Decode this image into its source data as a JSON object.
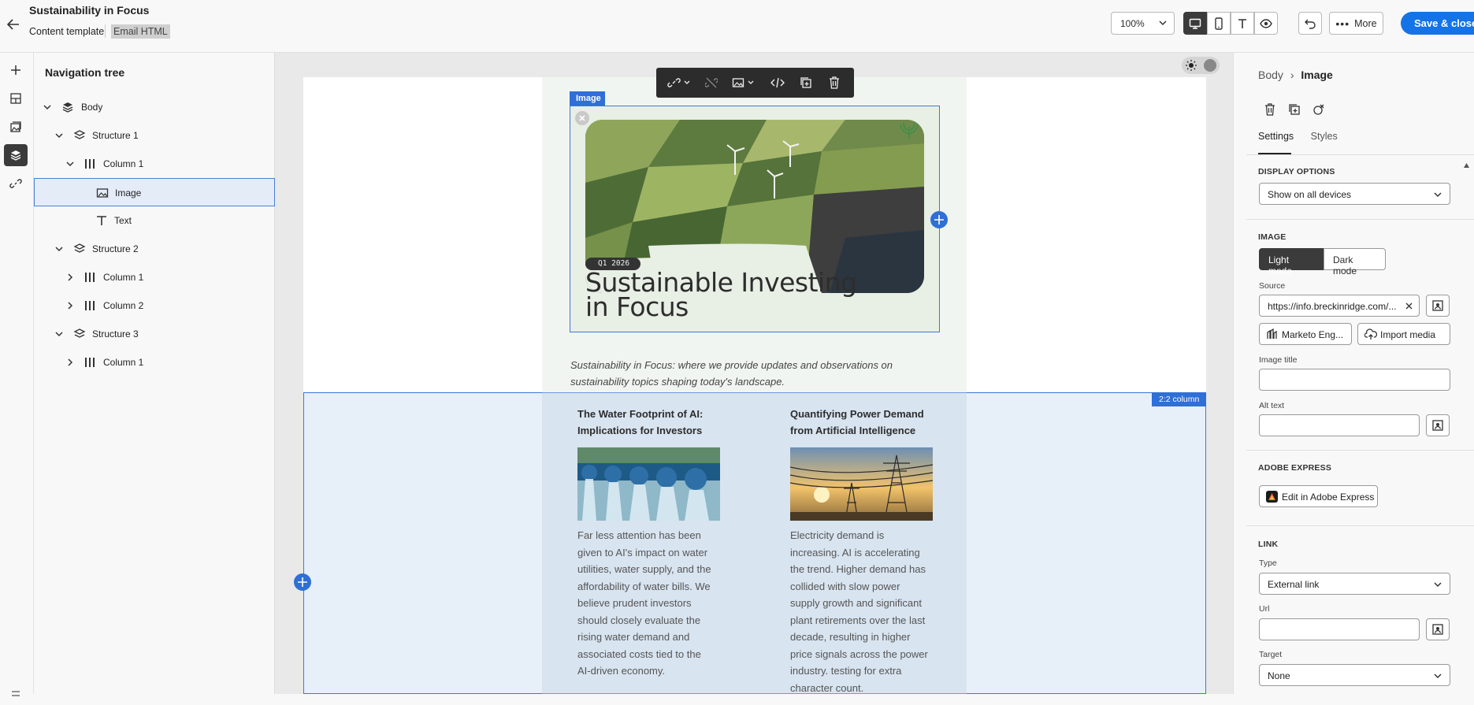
{
  "header": {
    "title": "Sustainability in Focus",
    "subtitle": "Content template",
    "badge": "Email HTML",
    "zoom": "100%",
    "more_label": "More",
    "save_label": "Save & close"
  },
  "nav": {
    "title": "Navigation tree",
    "nodes": [
      {
        "label": "Body"
      },
      {
        "label": "Structure 1"
      },
      {
        "label": "Column 1"
      },
      {
        "label": "Image"
      },
      {
        "label": "Text"
      },
      {
        "label": "Structure 2"
      },
      {
        "label": "Column 1"
      },
      {
        "label": "Column 2"
      },
      {
        "label": "Structure 3"
      },
      {
        "label": "Column 1"
      }
    ]
  },
  "canvas": {
    "image_tag": "Image",
    "hero_badge": "Q1 2026",
    "hero_title_1": "Sustainable Investing",
    "hero_title_2": "in Focus",
    "intro_1": "Sustainability in Focus: where we provide updates and observations on",
    "intro_2": "sustainability topics shaping today's landscape.",
    "column_tag": "2:2 column",
    "articles": [
      {
        "h1": "The Water Footprint of AI:",
        "h2": "Implications for Investors",
        "lines": [
          "Far less attention has been",
          "given to AI's impact on water",
          "utilities, water supply, and the",
          "affordability of water bills. We",
          "believe prudent investors",
          "should closely evaluate the",
          "rising water demand and",
          "associated costs tied to the",
          "AI-driven economy."
        ]
      },
      {
        "h1": "Quantifying Power Demand",
        "h2": "from Artificial Intelligence",
        "lines": [
          "Electricity demand is",
          "increasing. AI is accelerating",
          "the trend. Higher demand has",
          "collided with slow power",
          "supply growth and significant",
          "plant retirements over the last",
          "decade, resulting in higher",
          "price signals across the power",
          "industry. testing for extra",
          "character count."
        ]
      }
    ]
  },
  "panel": {
    "crumb_parent": "Body",
    "crumb_current": "Image",
    "tab_settings": "Settings",
    "tab_styles": "Styles",
    "display_options": "DISPLAY OPTIONS",
    "display_value": "Show on all devices",
    "image_section": "IMAGE",
    "light_mode": "Light mode",
    "dark_mode": "Dark mode",
    "source_label": "Source",
    "source_value": "https://info.breckinridge.com/...",
    "marketo": "Marketo Eng...",
    "import": "Import media",
    "image_title_label": "Image title",
    "image_title_value": "",
    "alt_label": "Alt text",
    "alt_value": "",
    "adobe_section": "ADOBE EXPRESS",
    "adobe_btn": "Edit in Adobe Express",
    "link_section": "LINK",
    "type_label": "Type",
    "type_value": "External link",
    "url_label": "Url",
    "url_value": "",
    "target_label": "Target",
    "target_value": "None"
  }
}
